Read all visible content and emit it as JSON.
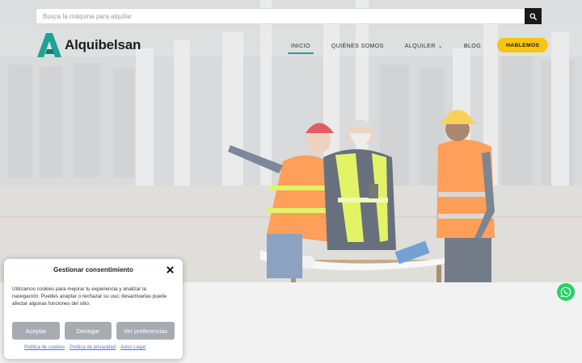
{
  "search": {
    "placeholder": "Busca la máquina para alquilar",
    "button_icon": "search-icon"
  },
  "logo": {
    "icon": "alquibelsan-a-logo-icon",
    "text": "Alquibelsan",
    "color": "#1fa394"
  },
  "nav": {
    "items": [
      {
        "label": "INICIO",
        "active": true
      },
      {
        "label": "QUIÉNES SOMOS",
        "active": false
      },
      {
        "label": "ALQUILER",
        "active": false,
        "dropdown_icon": "chevron-down-icon"
      },
      {
        "label": "BLOG",
        "active": false
      }
    ],
    "cta_label": "HABLEMOS",
    "cta_color": "#f6c513",
    "active_underline_color": "#1fa394"
  },
  "hero": {
    "image": "construction-workers-reviewing-plans-photo"
  },
  "whatsapp": {
    "icon": "whatsapp-icon",
    "color": "#25d366"
  },
  "cookie_dialog": {
    "title": "Gestionar consentimiento",
    "close_icon": "close-icon",
    "message": "Utilizamos cookies para mejorar tu experiencia y analizar la navegación. Puedes aceptar o rechazar su uso; desactivarlas puede afectar algunas funciones del sitio.",
    "buttons": {
      "accept": "Aceptar",
      "deny": "Denegar",
      "preferences": "Ver preferencias"
    },
    "button_color": "#a7acb3",
    "links": {
      "cookies": "Política de cookies",
      "privacy": "Política de privacidad",
      "legal": "Aviso Legal"
    }
  }
}
